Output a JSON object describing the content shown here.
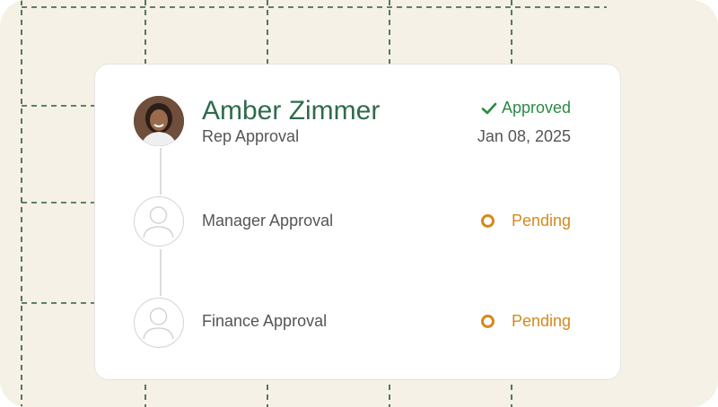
{
  "approval_card": {
    "approver_name": "Amber Zimmer",
    "steps": [
      {
        "label": "Rep Approval",
        "status": "Approved",
        "status_icon": "check-icon",
        "date": "Jan 08, 2025",
        "avatar": "user-photo"
      },
      {
        "label": "Manager Approval",
        "status": "Pending",
        "status_icon": "pending-circle-icon",
        "avatar": "user-placeholder-icon"
      },
      {
        "label": "Finance Approval",
        "status": "Pending",
        "status_icon": "pending-circle-icon",
        "avatar": "user-placeholder-icon"
      }
    ]
  },
  "colors": {
    "background": "#f5f1e6",
    "card": "#ffffff",
    "name": "#2f6b4c",
    "approved": "#2a8a44",
    "pending": "#d38a1c",
    "grid_lines": "#2f5a3c"
  }
}
